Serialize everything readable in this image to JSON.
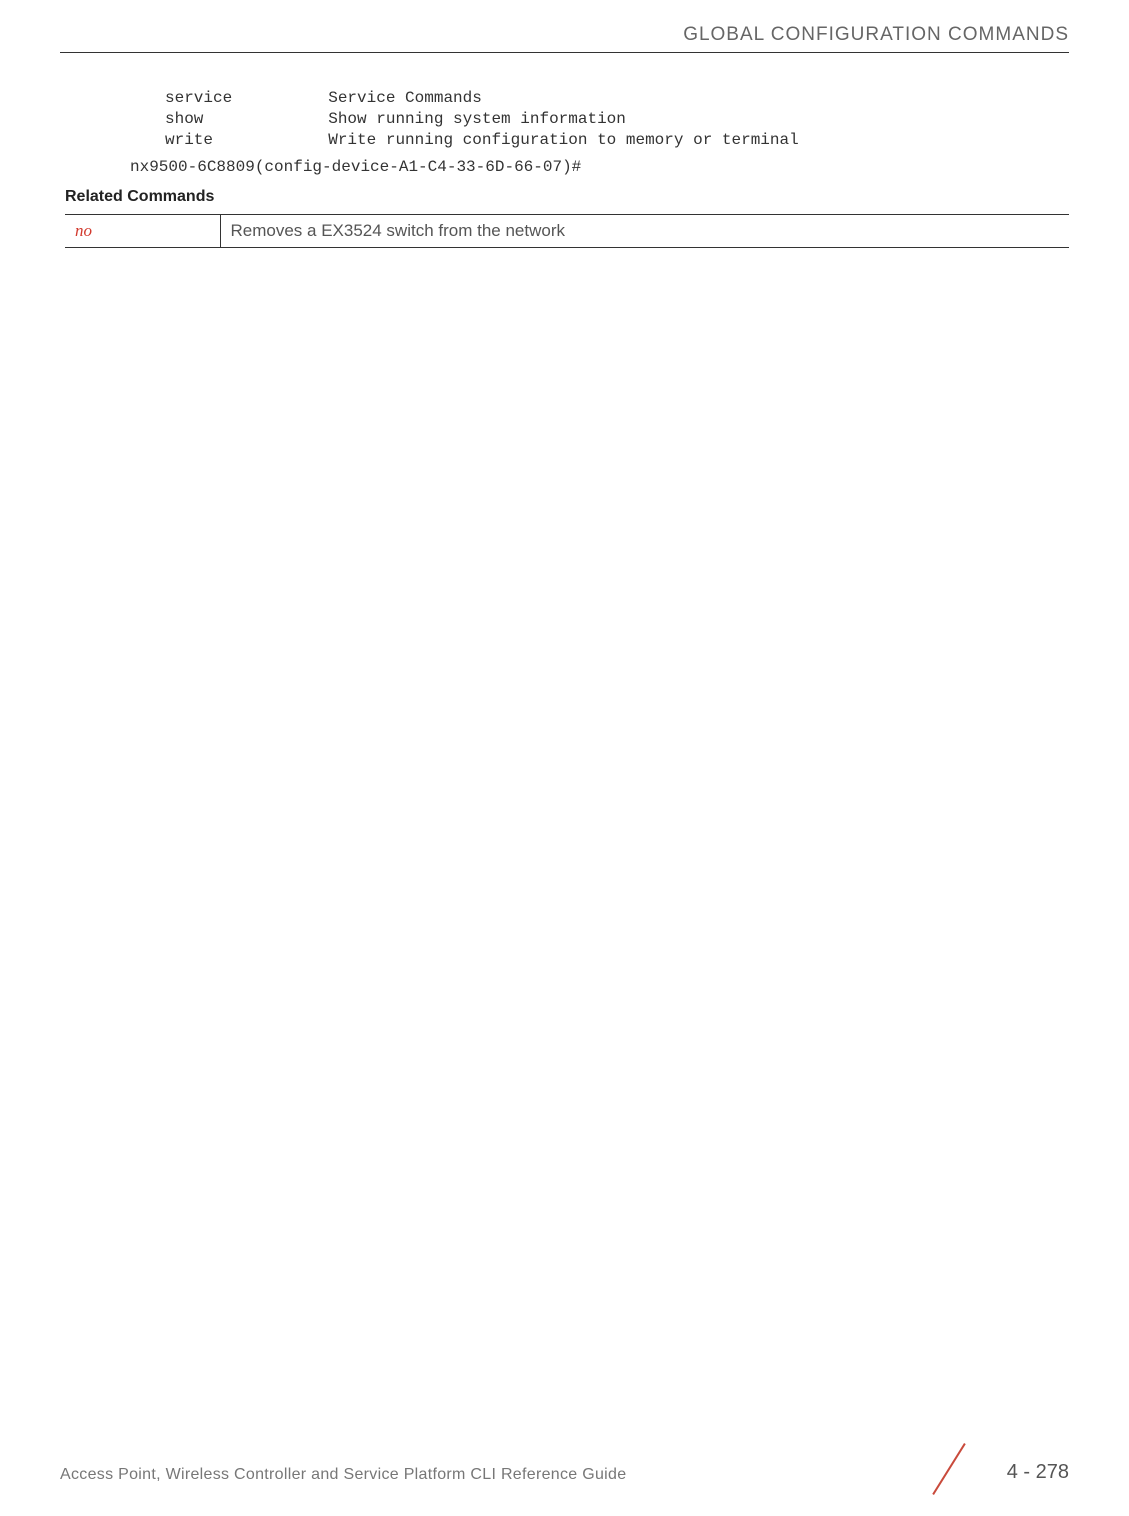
{
  "header": {
    "title": "GLOBAL CONFIGURATION COMMANDS"
  },
  "cli": {
    "lines": "service          Service Commands\nshow             Show running system information\nwrite            Write running configuration to memory or terminal",
    "prompt": "nx9500-6C8809(config-device-A1-C4-33-6D-66-07)#"
  },
  "sections": {
    "related_heading": "Related Commands"
  },
  "related_table": {
    "rows": [
      {
        "command": "no",
        "description": "Removes a EX3524 switch from the network"
      }
    ]
  },
  "footer": {
    "text": "Access Point, Wireless Controller and Service Platform CLI Reference Guide",
    "page": "4 - 278"
  }
}
